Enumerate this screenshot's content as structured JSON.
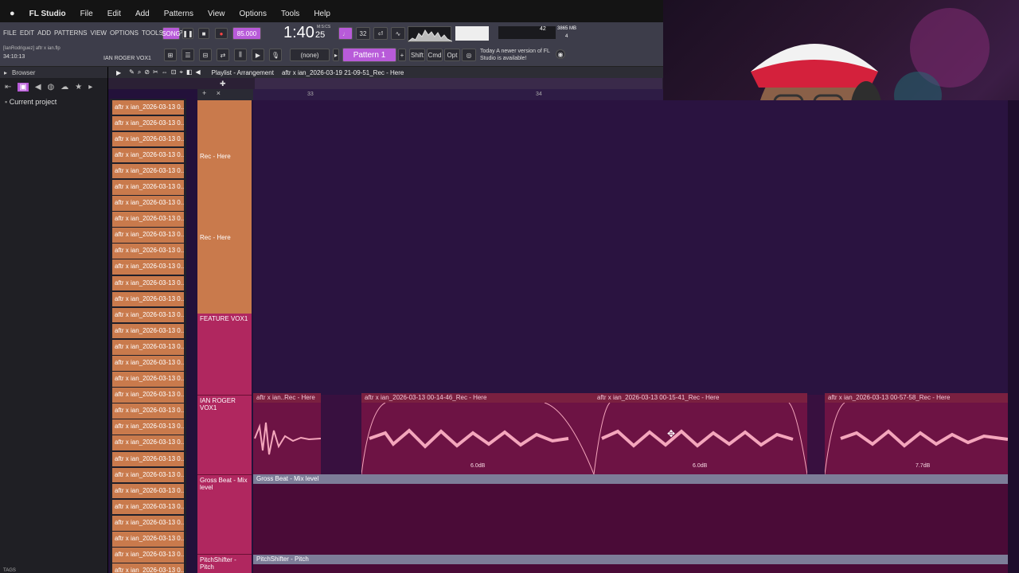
{
  "mac_menu": {
    "app": "FL Studio",
    "items": [
      "File",
      "Edit",
      "Add",
      "Patterns",
      "View",
      "Options",
      "Tools",
      "Help"
    ]
  },
  "fl_menu": [
    "FILE",
    "EDIT",
    "ADD",
    "PATTERNS",
    "VIEW",
    "OPTIONS",
    "TOOLS",
    "HELP"
  ],
  "project": {
    "user": "[IanRodriguez] aftr x ian.flp",
    "time": "34:10:13",
    "channel": "IAN ROGER VOX1"
  },
  "transport": {
    "mode": "SONG",
    "tempo": "85.000",
    "clock": "1:40",
    "clock_sub": "25",
    "clock_unit": "M:S:CS",
    "snap": "(none)",
    "pattern": "Pattern 1",
    "cpu": "42",
    "ram": "3865 MB",
    "voices": "4"
  },
  "keys": [
    "Shift",
    "Cmd",
    "Opt"
  ],
  "news": "Today  A newer version of FL Studio is available!",
  "browser": {
    "title": "Browser",
    "item": "Current project",
    "footer": "TAGS"
  },
  "playlist": {
    "title": "Playlist - Arrangement",
    "path": "aftr x ian_2026-03-19 21-09-51_Rec - Here"
  },
  "ruler_marks": [
    "33",
    "34"
  ],
  "clip_list_label": "aftr x ian_2026-03-13 0...",
  "tracks": {
    "rec1": "Rec - Here",
    "rec2": "Rec - Here",
    "feature": "FEATURE VOX1",
    "ian": "IAN ROGER VOX1",
    "gross": "Gross Beat - Mix level",
    "pitch": "PitchShifter - Pitch"
  },
  "clips": [
    {
      "name": "aftr x ian..Rec - Here",
      "db": ""
    },
    {
      "name": "aftr x ian_2026-03-13 00-14-46_Rec - Here",
      "db": "6.0dB"
    },
    {
      "name": "aftr x ian_2026-03-13 00-15-41_Rec - Here",
      "db": "6.0dB"
    },
    {
      "name": "aftr x ian_2026-03-13 00-57-58_Rec - Here",
      "db": "7.7dB"
    }
  ],
  "automation": {
    "gross": "Gross Beat - Mix level",
    "pitch": "PitchShifter - Pitch"
  },
  "colors": {
    "accent": "#c97a4c",
    "track_pink": "#b0275f",
    "grid": "#2a1340",
    "clip": "#6d1344"
  }
}
